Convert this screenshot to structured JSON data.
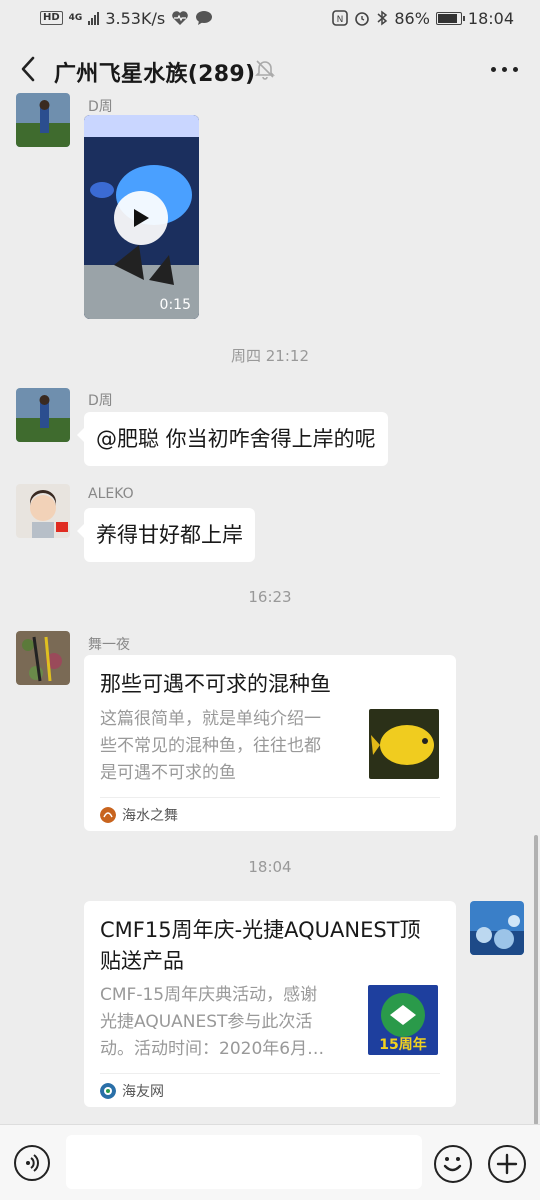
{
  "status_bar": {
    "hd": "HD",
    "network": "4G",
    "speed": "3.53K/s",
    "battery": "86%",
    "battery_level": 0.86,
    "time": "18:04"
  },
  "header": {
    "title": "广州飞星水族(289)",
    "icons": [
      "back-icon",
      "mute-bell-icon",
      "more-icon"
    ]
  },
  "messages": {
    "video_msg": {
      "sender": "D周",
      "duration": "0:15"
    },
    "ts1": "周四 21:12",
    "msg1": {
      "sender": "D周",
      "text": "@肥聪  你当初咋舍得上岸的呢"
    },
    "msg2": {
      "sender": "ALEKO",
      "text": "养得甘好都上岸"
    },
    "ts2": "16:23",
    "card1": {
      "sender": "舞一夜",
      "title": "那些可遇不可求的混种鱼",
      "desc_lines": [
        "这篇很简单，就是单纯介绍一",
        "些不常见的混种鱼，往往也都",
        "是可遇不可求的鱼"
      ],
      "source": "海水之舞"
    },
    "ts3": "18:04",
    "card2": {
      "title_lines": [
        "CMF15周年庆-光捷AQUANEST顶",
        "贴送产品"
      ],
      "desc_lines": [
        "CMF-15周年庆典活动，感谢",
        "光捷AQUANEST参与此次活",
        "动。活动时间：2020年6月…"
      ],
      "thumb_text": "15周年",
      "source": "海友网"
    }
  },
  "input_bar": {
    "placeholder": ""
  },
  "colors": {
    "bg": "#ededed",
    "bubble": "#ffffff",
    "meta": "#999999"
  }
}
